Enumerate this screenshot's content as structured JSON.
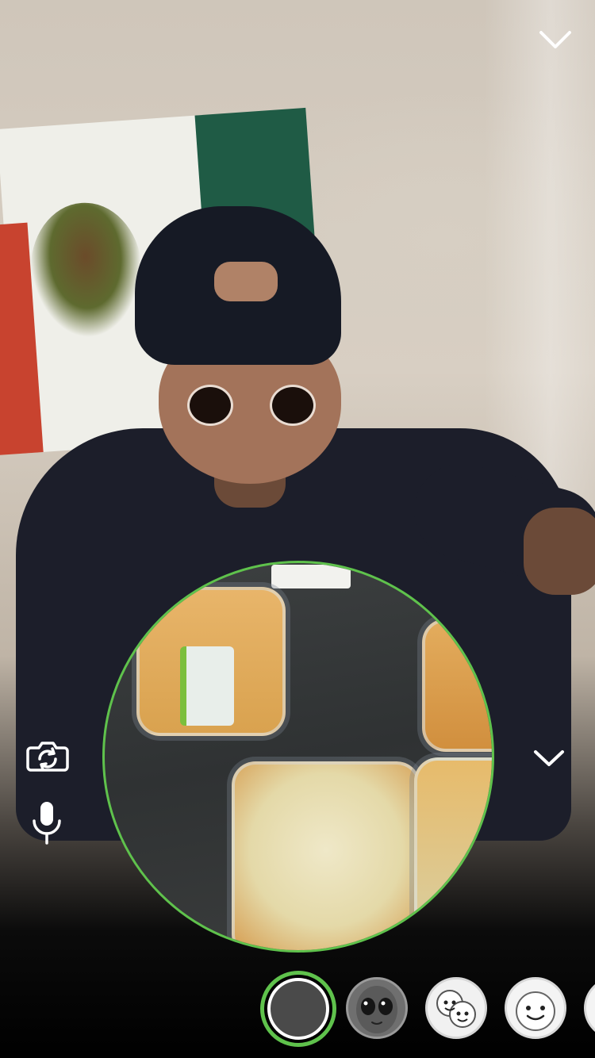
{
  "app": {
    "screen": "camera"
  },
  "icons": {
    "top_chevron": "chevron-down-icon",
    "flip_camera": "flip-camera-icon",
    "microphone": "microphone-icon",
    "side_chevron": "chevron-down-icon"
  },
  "colors": {
    "accent": "#5fc24c",
    "icon": "#ffffff"
  },
  "lenses": [
    {
      "id": "capture",
      "kind": "shutter",
      "selected": true
    },
    {
      "id": "alien-face",
      "kind": "face-lens"
    },
    {
      "id": "twin-faces",
      "kind": "face-lens"
    },
    {
      "id": "smile-face",
      "kind": "face-lens"
    },
    {
      "id": "partial-face",
      "kind": "face-lens"
    }
  ]
}
